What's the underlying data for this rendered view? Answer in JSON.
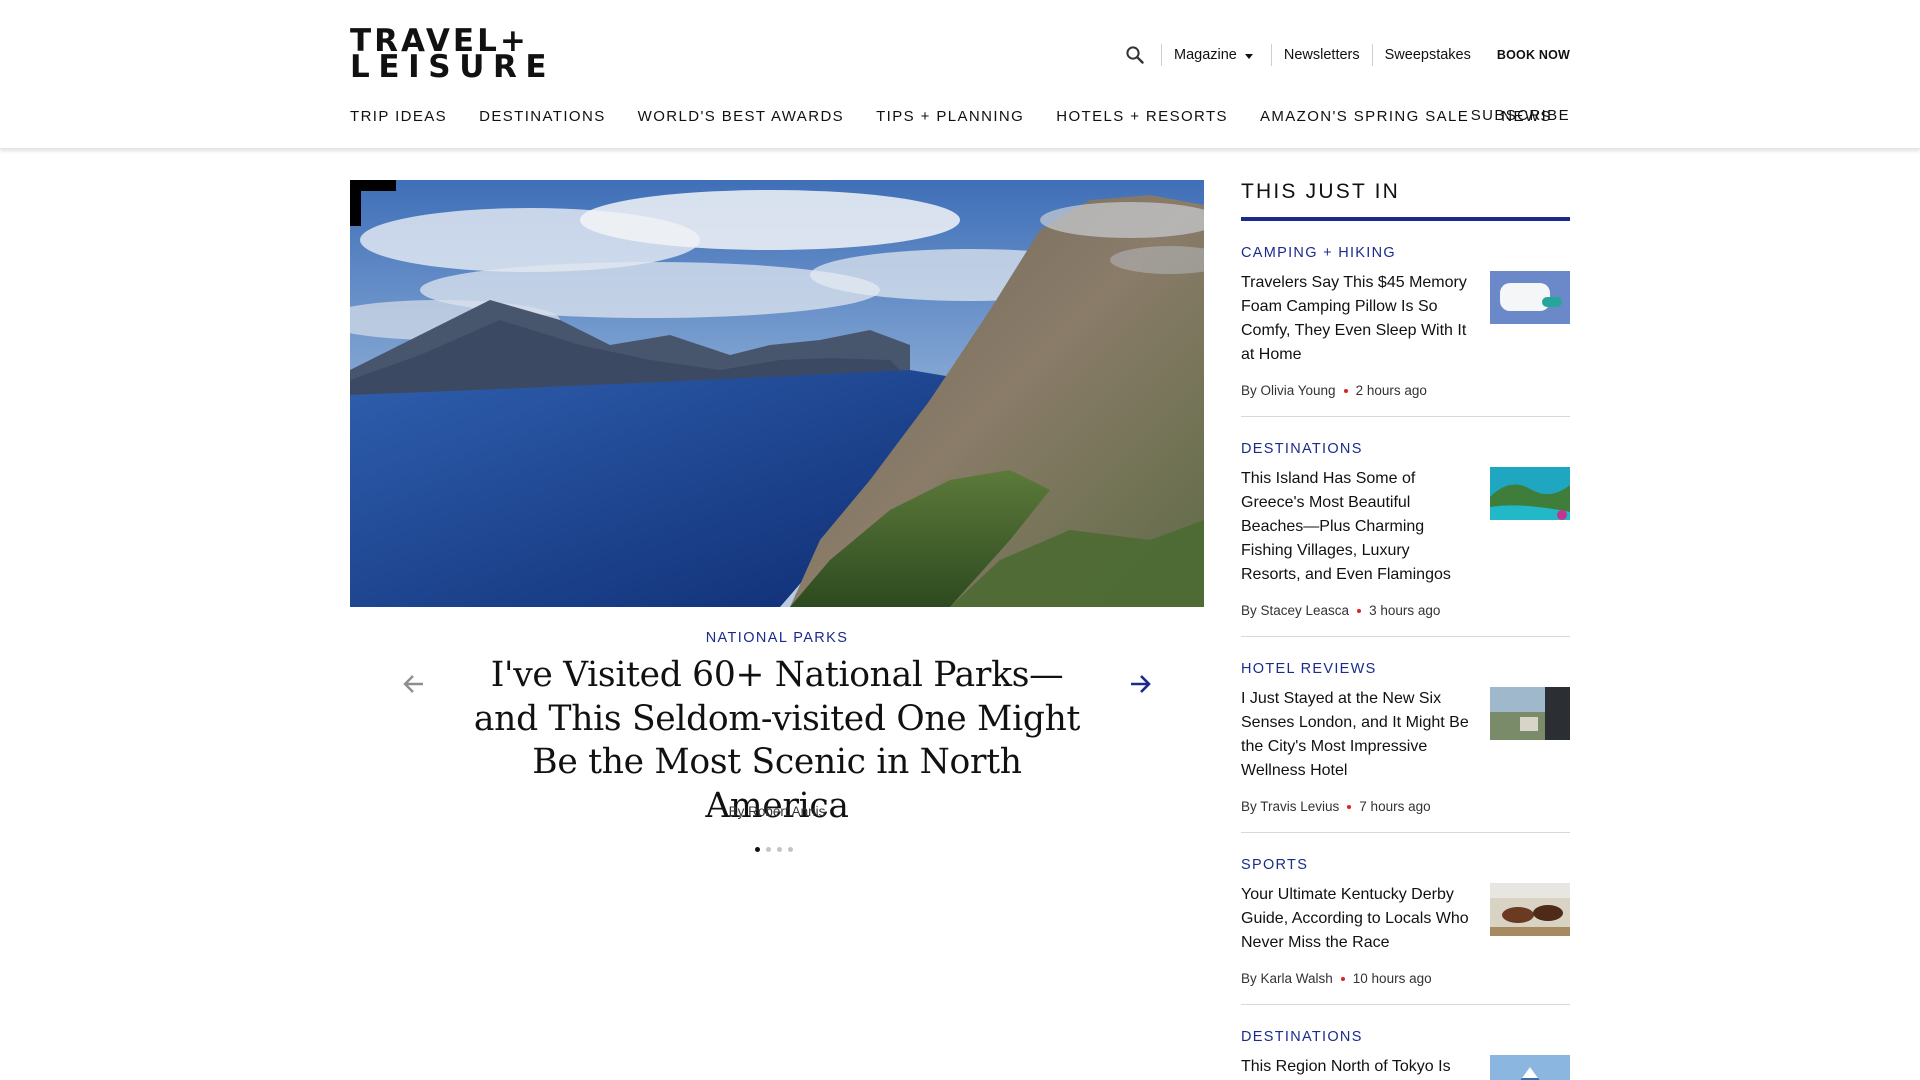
{
  "header": {
    "logo_line1": "TRAVEL+",
    "logo_line2": "LEISURE",
    "magazine_label": "Magazine",
    "newsletters_label": "Newsletters",
    "sweepstakes_label": "Sweepstakes",
    "book_now_label": "BOOK NOW",
    "subscribe_label": "SUBSCRIBE",
    "nav": [
      "TRIP IDEAS",
      "DESTINATIONS",
      "WORLD'S BEST AWARDS",
      "TIPS + PLANNING",
      "HOTELS + RESORTS",
      "AMAZON'S SPRING SALE",
      "NEWS"
    ]
  },
  "hero": {
    "image_alt": "Aerial view of a fjord with mountains",
    "category": "NATIONAL PARKS",
    "title": "I've Visited 60+ National Parks—and This Seldom-visited One Might Be the Most Scenic in North America",
    "byline": "By Robert Annis",
    "slide_count": 4,
    "active_slide": 1
  },
  "sidebar": {
    "heading": "THIS JUST IN",
    "stories": [
      {
        "category": "CAMPING + HIKING",
        "title": "Travelers Say This $45 Memory Foam Camping Pillow Is So Comfy, They Even Sleep With It at Home",
        "author": "By Olivia Young",
        "time": "2 hours ago",
        "thumb": "pillow"
      },
      {
        "category": "DESTINATIONS",
        "title": "This Island Has Some of Greece's Most Beautiful Beaches—Plus Charming Fishing Villages, Luxury Resorts, and Even Flamingos",
        "author": "By Stacey Leasca",
        "time": "3 hours ago",
        "thumb": "island"
      },
      {
        "category": "HOTEL REVIEWS",
        "title": "I Just Stayed at the New Six Senses London, and It Might Be the City's Most Impressive Wellness Hotel",
        "author": "By Travis Levius",
        "time": "7 hours ago",
        "thumb": "hotel"
      },
      {
        "category": "SPORTS",
        "title": "Your Ultimate Kentucky Derby Guide, According to Locals Who Never Miss the Race",
        "author": "By Karla Walsh",
        "time": "10 hours ago",
        "thumb": "derby"
      },
      {
        "category": "DESTINATIONS",
        "title": "This Region North of Tokyo Is",
        "author": "",
        "time": "",
        "thumb": "fuji"
      }
    ]
  },
  "colors": {
    "accent": "#1b2b8c",
    "bullet": "#dd2222",
    "text": "#111111"
  },
  "icons": {
    "search": "search-icon",
    "caret": "chevron-down-icon",
    "prev": "arrow-left-icon",
    "next": "arrow-right-icon"
  }
}
